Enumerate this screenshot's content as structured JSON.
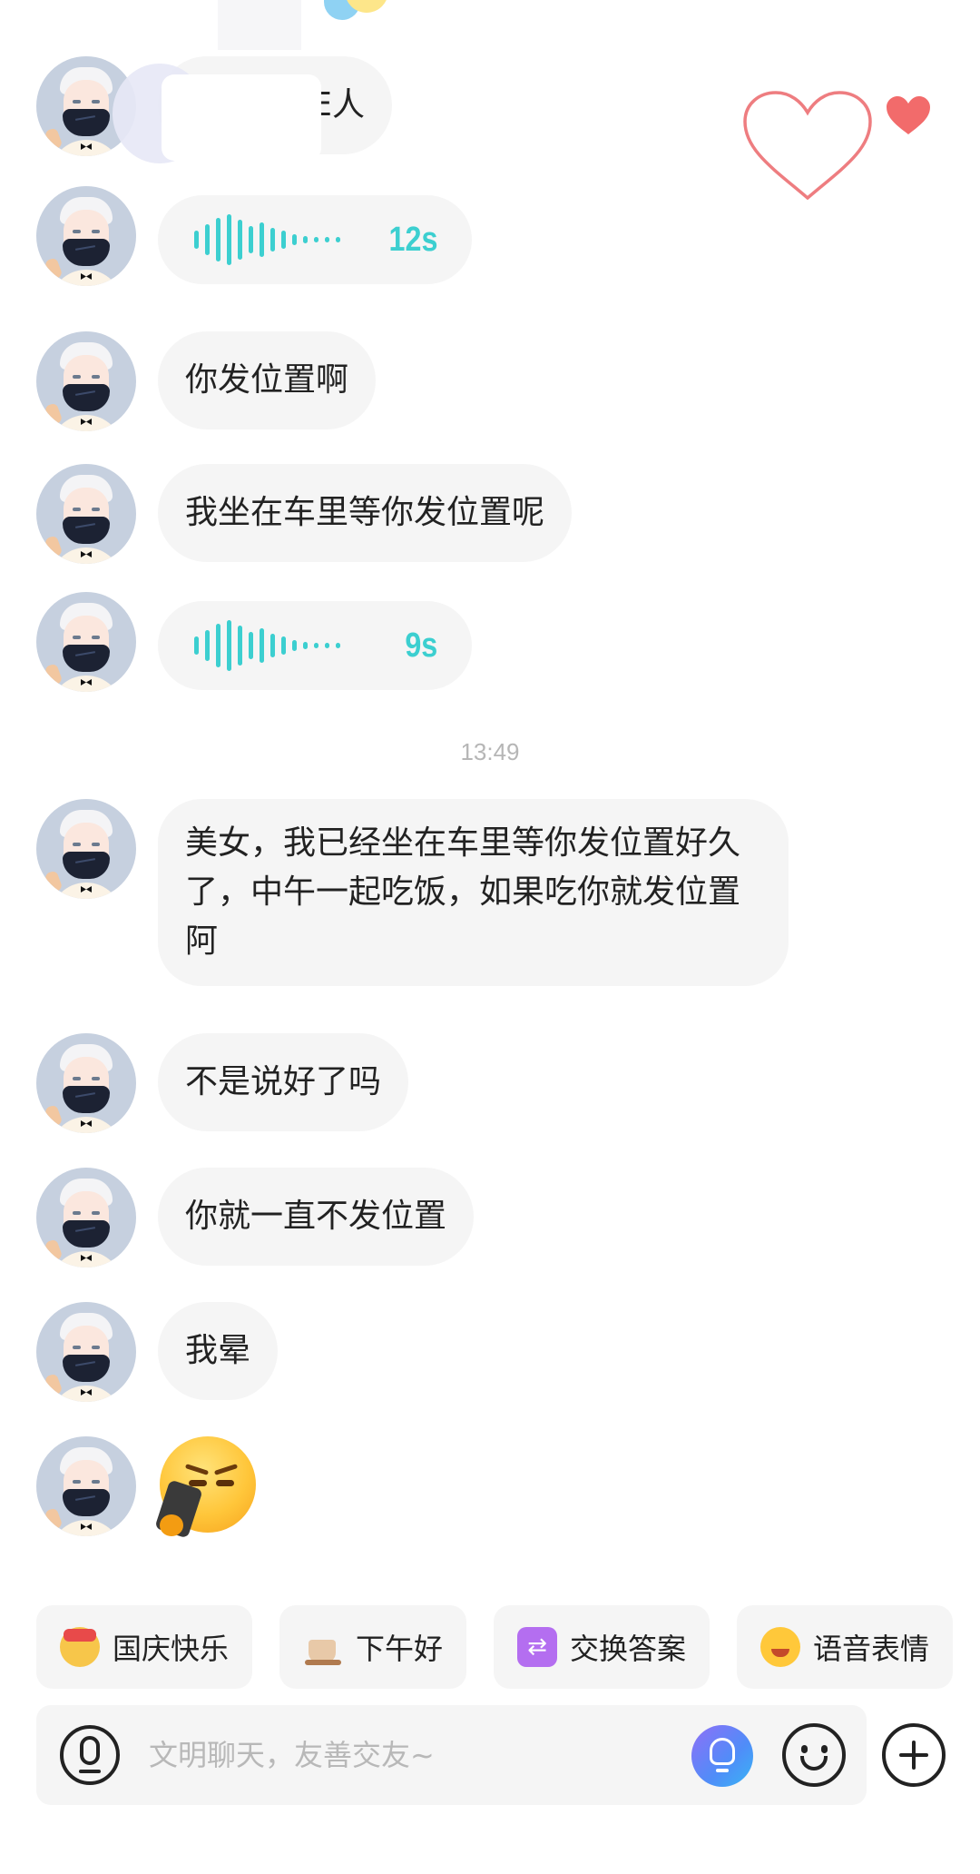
{
  "colors": {
    "accent_teal": "#3ccfd0",
    "bubble_bg": "#f5f5f5",
    "heart_red": "#f26b6b"
  },
  "messages": [
    {
      "type": "text",
      "text": "E人",
      "partially_redacted": true
    },
    {
      "type": "voice",
      "duration": "12s"
    },
    {
      "type": "text",
      "text": "你发位置啊"
    },
    {
      "type": "text",
      "text": "我坐在车里等你发位置呢"
    },
    {
      "type": "voice",
      "duration": "9s"
    },
    {
      "type": "timestamp",
      "text": "13:49"
    },
    {
      "type": "text",
      "text": "美女，我已经坐在车里等你发位置好久了，中午一起吃饭，如果吃你就发位置阿"
    },
    {
      "type": "text",
      "text": "不是说好了吗"
    },
    {
      "type": "text",
      "text": "你就一直不发位置"
    },
    {
      "type": "text",
      "text": "我晕"
    },
    {
      "type": "sticker",
      "icon": "angry-phone-emoji-icon"
    }
  ],
  "quick_replies": [
    {
      "label": "国庆快乐",
      "icon": "national-day-emoji-icon"
    },
    {
      "label": "下午好",
      "icon": "coffee-cup-icon"
    },
    {
      "label": "交换答案",
      "icon": "swap-icon"
    },
    {
      "label": "语音表情",
      "icon": "tongue-emoji-icon"
    }
  ],
  "input": {
    "placeholder": "文明聊天，友善交友~",
    "value": ""
  },
  "icons": {
    "mic": "microphone-icon",
    "ai": "ai-bulb-icon",
    "emoji": "smiley-icon",
    "plus": "plus-icon",
    "like": "heart-icon"
  }
}
